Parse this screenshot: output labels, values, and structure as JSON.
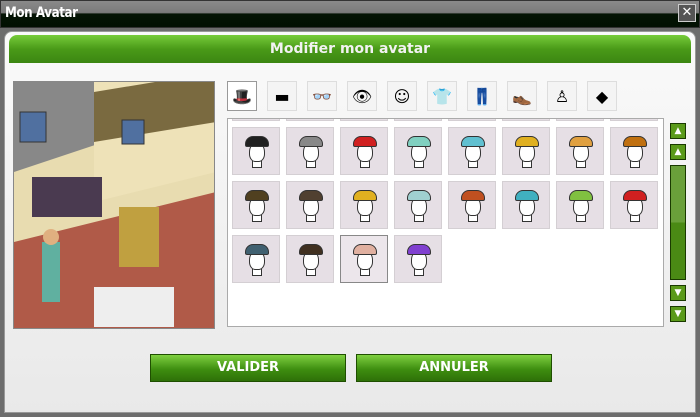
{
  "window": {
    "title": "Mon Avatar",
    "close": "✕"
  },
  "header": {
    "title": "Modifier mon avatar"
  },
  "tabs": [
    {
      "name": "hats",
      "glyph": "🎩"
    },
    {
      "name": "hair",
      "glyph": "▬"
    },
    {
      "name": "glasses",
      "glyph": "👓"
    },
    {
      "name": "eyes",
      "glyph": "👁"
    },
    {
      "name": "face",
      "glyph": "☺"
    },
    {
      "name": "shirt",
      "glyph": "👕"
    },
    {
      "name": "pants",
      "glyph": "👖"
    },
    {
      "name": "shoes",
      "glyph": "👞"
    },
    {
      "name": "body",
      "glyph": "♙"
    },
    {
      "name": "effects",
      "glyph": "◆"
    }
  ],
  "items": [
    {
      "hat": null
    },
    {
      "hat": "#d02020"
    },
    {
      "hat": "#ffffff"
    },
    {
      "hat": "#c02020"
    },
    {
      "hat": "#2080d0"
    },
    {
      "hat": "#30b030"
    },
    {
      "hat": "#b040c0"
    },
    {
      "hat": "#d07020"
    },
    {
      "hat": "#202020"
    },
    {
      "hat": "#888888"
    },
    {
      "hat": "#d02020"
    },
    {
      "hat": "#80d0c0"
    },
    {
      "hat": "#60c0d0"
    },
    {
      "hat": "#e0b020"
    },
    {
      "hat": "#e0a040"
    },
    {
      "hat": "#c07010"
    },
    {
      "hat": "#504020"
    },
    {
      "hat": "#504030"
    },
    {
      "hat": "#e0b020"
    },
    {
      "hat": "#a0d0d0"
    },
    {
      "hat": "#c05020"
    },
    {
      "hat": "#40b0c0"
    },
    {
      "hat": "#80c040"
    },
    {
      "hat": "#d02020"
    },
    {
      "hat": "#406070"
    },
    {
      "hat": "#403020"
    },
    {
      "hat": "#e0b0a0",
      "selected": true
    },
    {
      "hat": "#8040d0"
    }
  ],
  "buttons": {
    "validate": "VALIDER",
    "cancel": "ANNULER"
  },
  "colors": {
    "accent": "#4a9a18"
  }
}
